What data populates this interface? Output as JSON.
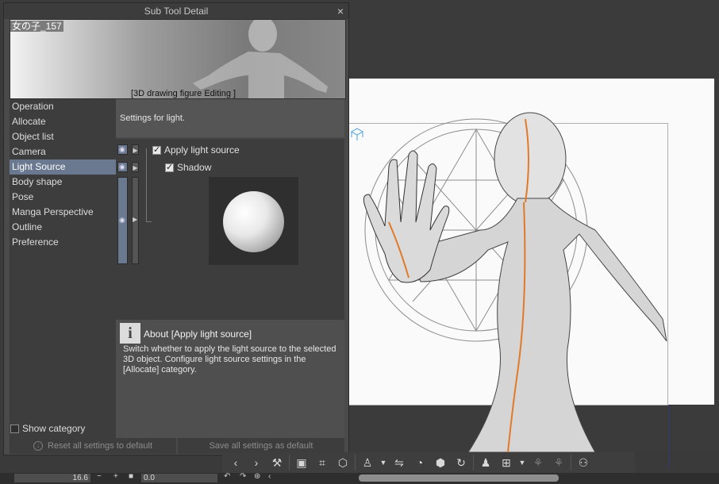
{
  "dialog": {
    "title": "Sub Tool Detail",
    "close_glyph": "×",
    "preview": {
      "name": "女の子_157",
      "caption": "[3D drawing figure Editing ]"
    },
    "categories": [
      {
        "label": "Operation"
      },
      {
        "label": "Allocate"
      },
      {
        "label": "Object list"
      },
      {
        "label": "Camera"
      },
      {
        "label": "Light Source",
        "selected": true
      },
      {
        "label": "Body shape"
      },
      {
        "label": "Pose"
      },
      {
        "label": "Manga Perspective"
      },
      {
        "label": "Outline"
      },
      {
        "label": "Preference"
      }
    ],
    "show_category_label": "Show category",
    "show_category_checked": false,
    "settings_header": "Settings for light.",
    "apply_light_label": "Apply light source",
    "apply_light_checked": true,
    "shadow_label": "Shadow",
    "shadow_checked": true,
    "about": {
      "icon": "i",
      "title": "About [Apply light source]",
      "text": "Switch whether to apply the light source to the selected 3D object. Configure light source settings in the [Allocate] category."
    },
    "footer": {
      "reset_label": "Reset all settings to default",
      "save_label": "Save all settings as default"
    }
  },
  "toolbar": {
    "icons": [
      "chevron-left-icon",
      "chevron-right-icon",
      "wrench-icon",
      "camera-frame-icon",
      "crop-icon",
      "cube-icon",
      "figure-move-icon",
      "flip-icon",
      "rotate-dial-icon",
      "hex-rotate-icon",
      "rotate-arrow-icon",
      "figure-add-icon",
      "figure-pose-icon",
      "figure-sit-icon",
      "figure-lie-icon",
      "figure-pair-icon"
    ]
  },
  "statusbar": {
    "zoom_value": "16.6",
    "angle_value": "0.0"
  },
  "colors": {
    "selection": "#6a7890",
    "panel": "#4a4a4a",
    "canvas": "#3b3b3b",
    "seam_line": "#e07a2a"
  }
}
